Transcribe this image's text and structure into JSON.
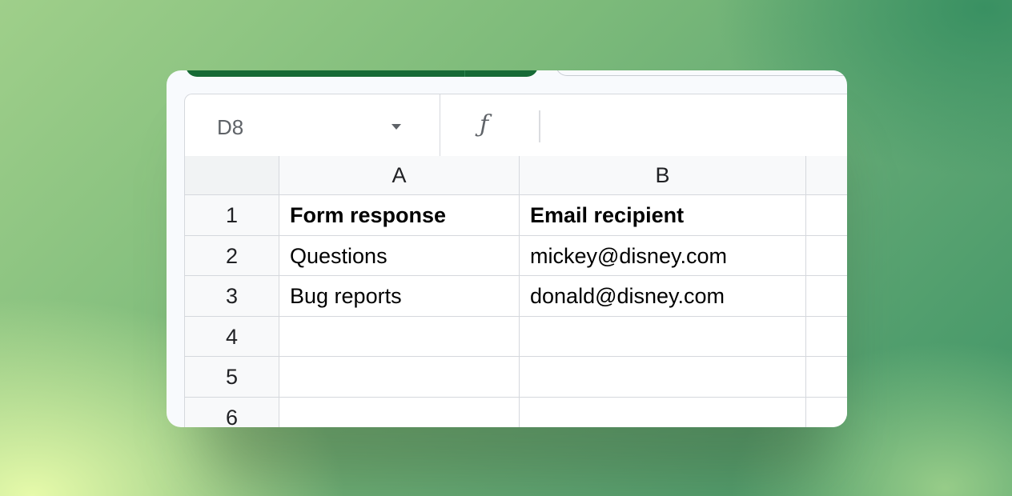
{
  "formula_bar": {
    "name_box": "D8",
    "fx_symbol": "ƒ",
    "formula_value": ""
  },
  "columns": [
    "A",
    "B"
  ],
  "rows": [
    {
      "number": "1",
      "a": "Form response",
      "b": "Email recipient"
    },
    {
      "number": "2",
      "a": "Questions",
      "b": "mickey@disney.com"
    },
    {
      "number": "3",
      "a": "Bug reports",
      "b": "donald@disney.com"
    },
    {
      "number": "4",
      "a": "",
      "b": ""
    },
    {
      "number": "5",
      "a": "",
      "b": ""
    },
    {
      "number": "6",
      "a": "",
      "b": ""
    }
  ],
  "colors": {
    "header_fill": "#f8f9fa",
    "gridline": "#d5d8dd",
    "top_tab_accent": "#176a36"
  },
  "icons": {
    "name_box_dropdown": "caret-down-icon",
    "formula": "function-icon"
  }
}
